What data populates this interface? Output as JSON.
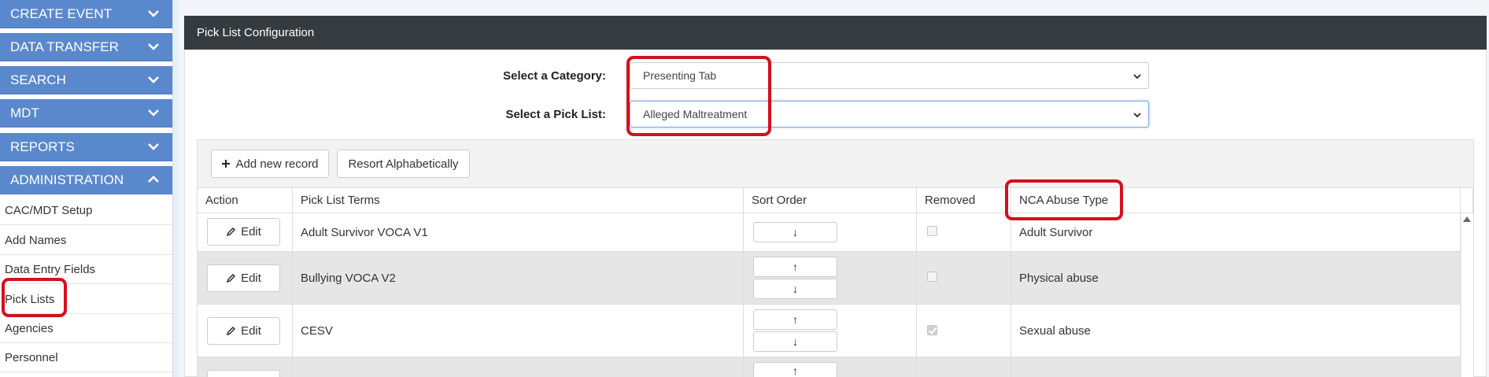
{
  "sidebar": {
    "sections": [
      {
        "label": "CREATE EVENT",
        "state": "collapsed"
      },
      {
        "label": "DATA TRANSFER",
        "state": "collapsed"
      },
      {
        "label": "SEARCH",
        "state": "collapsed"
      },
      {
        "label": "MDT",
        "state": "collapsed"
      },
      {
        "label": "REPORTS",
        "state": "collapsed"
      },
      {
        "label": "ADMINISTRATION",
        "state": "expanded"
      }
    ],
    "admin_items": [
      "CAC/MDT Setup",
      "Add Names",
      "Data Entry Fields",
      "Pick Lists",
      "Agencies",
      "Personnel"
    ]
  },
  "panel": {
    "title": "Pick List Configuration"
  },
  "form": {
    "category_label": "Select a Category:",
    "category_value": "Presenting Tab",
    "picklist_label": "Select a Pick List:",
    "picklist_value": "Alleged Maltreatment"
  },
  "toolbar": {
    "add_label": "Add new record",
    "resort_label": "Resort Alphabetically"
  },
  "table": {
    "columns": [
      "Action",
      "Pick List Terms",
      "Sort Order",
      "Removed",
      "NCA Abuse Type"
    ],
    "edit_label": "Edit",
    "rows": [
      {
        "term": "Adult Survivor VOCA V1",
        "removed": false,
        "nca_type": "Adult Survivor"
      },
      {
        "term": "Bullying VOCA V2",
        "removed": false,
        "nca_type": "Physical abuse"
      },
      {
        "term": "CESV",
        "removed": true,
        "nca_type": "Sexual abuse"
      }
    ]
  },
  "colors": {
    "nav_blue": "#5a88cc",
    "panel_header": "#353b3f",
    "highlight_red": "#d3111c"
  }
}
